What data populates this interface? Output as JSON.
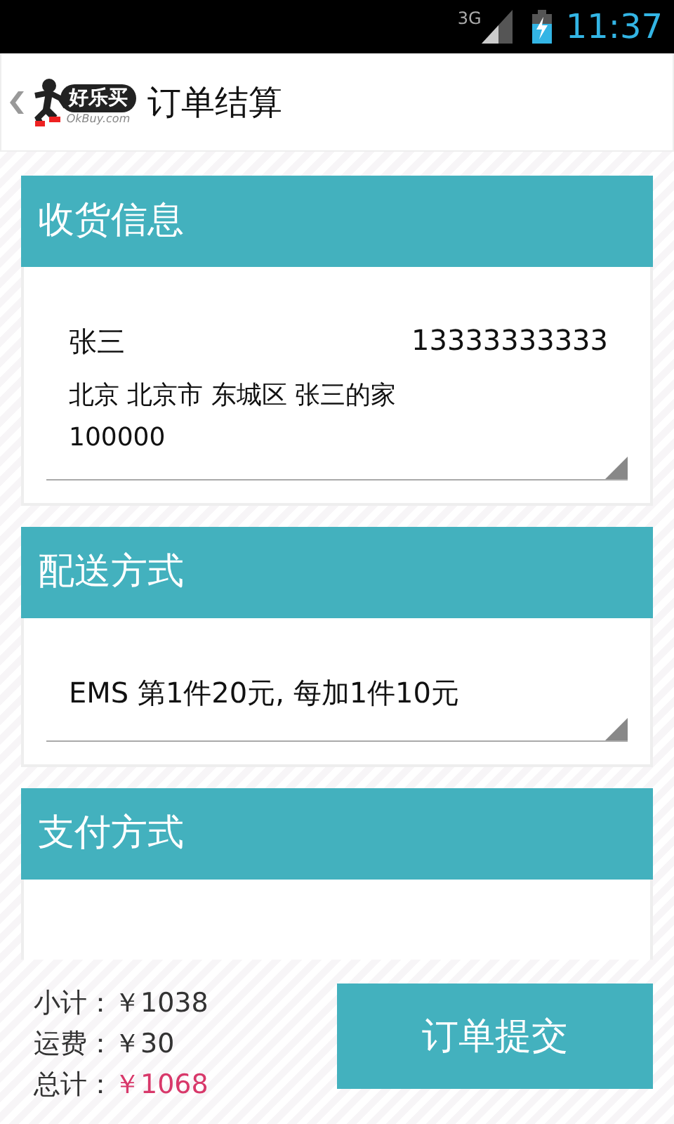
{
  "status_bar": {
    "network": "3G",
    "time": "11:37"
  },
  "header": {
    "logo_text": "好乐买",
    "logo_subtext": "OkBuy.com",
    "title": "订单结算"
  },
  "sections": [
    {
      "kind": "address",
      "title": "收货信息",
      "name": "张三",
      "phone": "13333333333",
      "address": "北京 北京市 东城区 张三的家",
      "postcode": "100000"
    },
    {
      "kind": "shipping",
      "title": "配送方式",
      "text": "EMS  第1件20元, 每加1件10元"
    },
    {
      "kind": "payment",
      "title": "支付方式"
    }
  ],
  "summary": [
    {
      "label": "小计：",
      "value": "￥1038",
      "highlight": false
    },
    {
      "label": "运费：",
      "value": "￥30",
      "highlight": false
    },
    {
      "label": "总计：",
      "value": "￥1068",
      "highlight": true
    }
  ],
  "submit_button": "订单提交"
}
